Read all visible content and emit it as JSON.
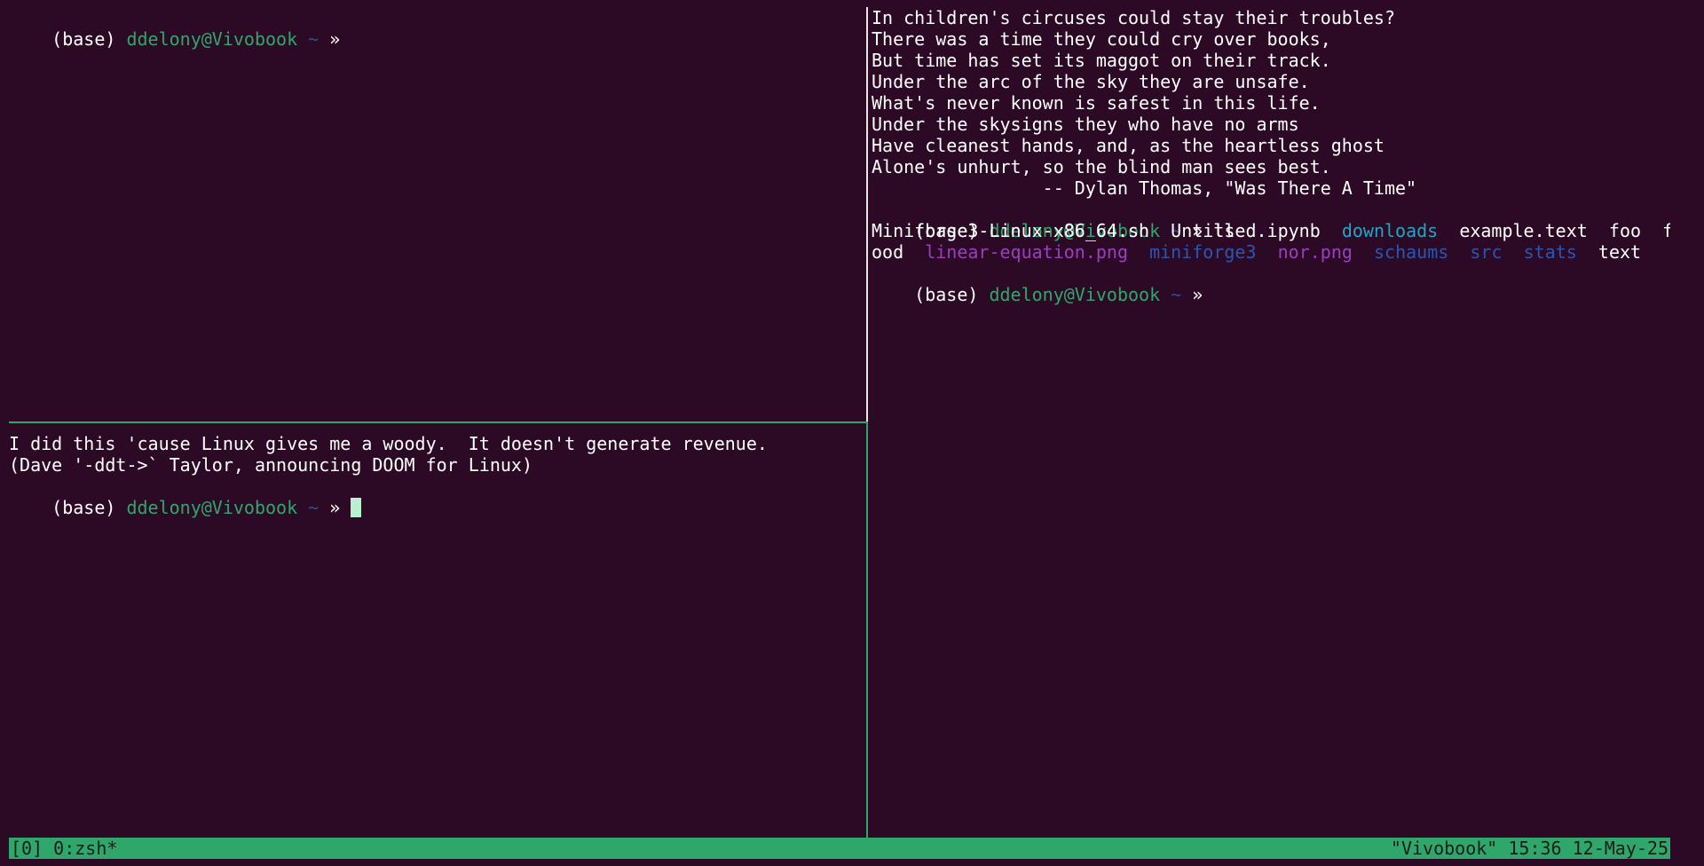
{
  "prompt": {
    "env": "(base)",
    "user_host": "ddelony@Vivobook",
    "tilde": "~",
    "arrow": "»"
  },
  "top_left": {
    "lines": []
  },
  "bottom_left": {
    "fortune_lines": [
      "I did this 'cause Linux gives me a woody.  It doesn't generate revenue.",
      "(Dave '-ddt->` Taylor, announcing DOOM for Linux)"
    ]
  },
  "right": {
    "poem_lines": [
      "In children's circuses could stay their troubles?",
      "There was a time they could cry over books,",
      "But time has set its maggot on their track.",
      "Under the arc of the sky they are unsafe.",
      "What's never known is safest in this life.",
      "Under the skysigns they who have no arms",
      "Have cleanest hands, and, as the heartless ghost",
      "Alone's unhurt, so the blind man sees best.",
      "                -- Dylan Thomas, \"Was There A Time\""
    ],
    "command": "ls",
    "ls_row1": [
      {
        "name": "Miniforge3-Linux-x86_64.sh",
        "color": "white"
      },
      {
        "name": "Untitled.ipynb",
        "color": "white"
      },
      {
        "name": "downloads",
        "color": "cyan"
      },
      {
        "name": "example.text",
        "color": "white"
      },
      {
        "name": "foo",
        "color": "white"
      },
      {
        "name": "f",
        "color": "white"
      }
    ],
    "ls_row2": [
      {
        "name": "ood",
        "color": "white"
      },
      {
        "name": "linear-equation.png",
        "color": "magenta"
      },
      {
        "name": "miniforge3",
        "color": "blue"
      },
      {
        "name": "nor.png",
        "color": "magenta"
      },
      {
        "name": "schaums",
        "color": "blue"
      },
      {
        "name": "src",
        "color": "blue"
      },
      {
        "name": "stats",
        "color": "blue"
      },
      {
        "name": "text",
        "color": "white"
      }
    ]
  },
  "status_bar": {
    "left": "[0] 0:zsh*",
    "right": "\"Vivobook\" 15:36 12-May-25"
  },
  "colors": {
    "background": "#2c0a25",
    "user_host": "#2fa76a",
    "tilde": "#2c4f8f",
    "status_bar": "#2fa76a",
    "ls_dir_cyan": "#22a6c8",
    "ls_image_magenta": "#9b3fc0",
    "ls_dir_blue": "#2a56b3"
  }
}
